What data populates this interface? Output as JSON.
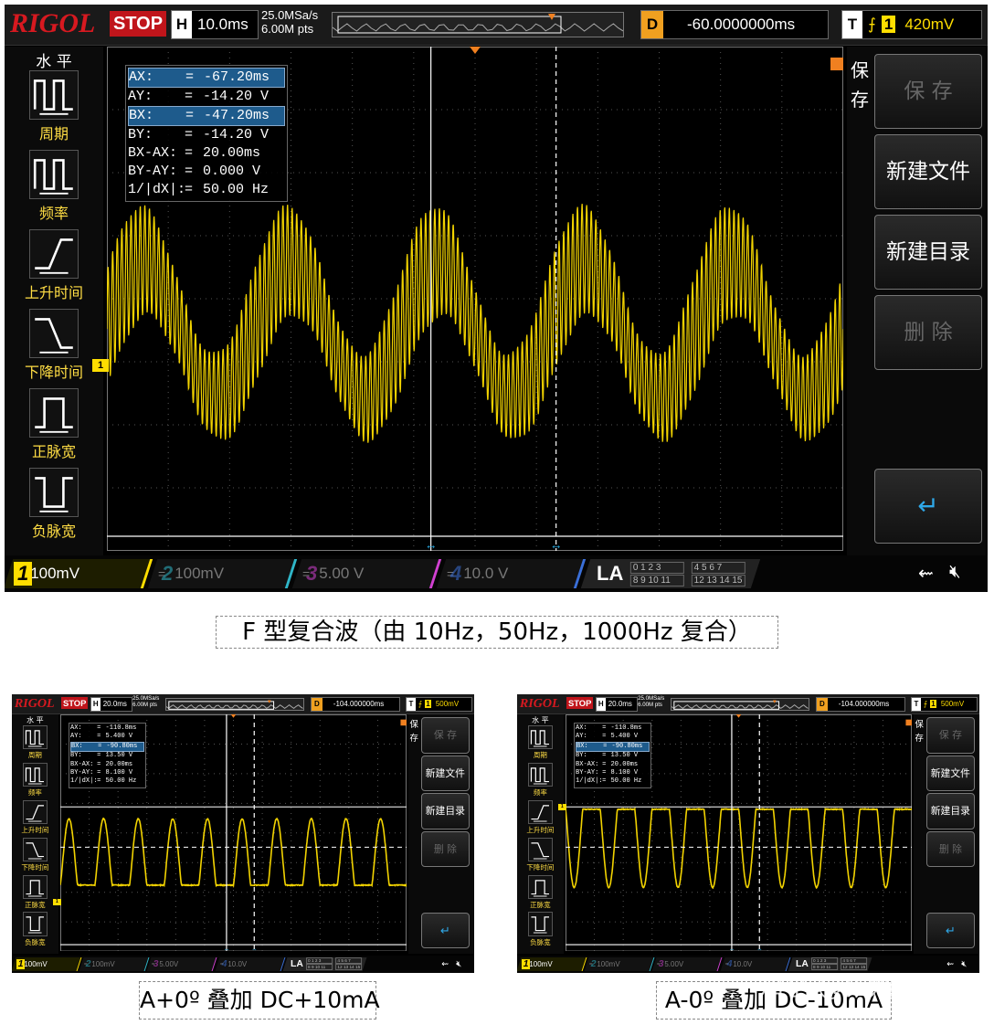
{
  "scopes": [
    {
      "id": "main",
      "brand": "RIGOL",
      "run_state": "STOP",
      "h_label": "H",
      "timebase": "10.0ms",
      "sample_rate": "25.0MSa/s",
      "memory_depth": "6.00M pts",
      "d_label": "D",
      "delay": "-60.0000000ms",
      "trigger_label": "T",
      "trigger_channel": "1",
      "trigger_level": "420mV",
      "menu_title": "水 平",
      "left_menu": [
        "周期",
        "频率",
        "上升时间",
        "下降时间",
        "正脉宽",
        "负脉宽"
      ],
      "right_menu_title": "保存",
      "right_menu": [
        {
          "label": "保 存",
          "enabled": false
        },
        {
          "label": "新建文件",
          "enabled": true
        },
        {
          "label": "新建目录",
          "enabled": true
        },
        {
          "label": "删 除",
          "enabled": false
        }
      ],
      "measurements": [
        {
          "name": "AX:",
          "value": "-67.20ms",
          "highlight": true
        },
        {
          "name": "AY:",
          "value": "-14.20 V",
          "highlight": false
        },
        {
          "name": "BX:",
          "value": "-47.20ms",
          "highlight": true
        },
        {
          "name": "BY:",
          "value": "-14.20 V",
          "highlight": false
        },
        {
          "name": "BX-AX:",
          "value": "20.00ms",
          "highlight": false
        },
        {
          "name": "BY-AY:",
          "value": "0.000 V",
          "highlight": false
        },
        {
          "name": "1/|dX|:",
          "value": "50.00 Hz",
          "highlight": false
        }
      ],
      "channels": [
        {
          "num": "1",
          "scale": "100mV",
          "color": "#ffde00"
        },
        {
          "num": "2",
          "scale": "100mV",
          "color": "#2fb6c8"
        },
        {
          "num": "3",
          "scale": "5.00 V",
          "color": "#d040d0"
        },
        {
          "num": "4",
          "scale": "10.0 V",
          "color": "#3a6fd8"
        }
      ],
      "la_label": "LA",
      "la_groups": [
        "0 1 2 3",
        "4 5 6 7",
        "8 9 10 11",
        "12 13 14 15"
      ]
    },
    {
      "id": "left",
      "brand": "RIGOL",
      "run_state": "STOP",
      "h_label": "H",
      "timebase": "20.0ms",
      "sample_rate": "25.0MSa/s",
      "memory_depth": "6.00M pts",
      "d_label": "D",
      "delay": "-104.000000ms",
      "trigger_label": "T",
      "trigger_channel": "1",
      "trigger_level": "500mV",
      "menu_title": "水 平",
      "left_menu": [
        "周期",
        "频率",
        "上升时间",
        "下降时间",
        "正脉宽",
        "负脉宽"
      ],
      "right_menu_title": "保存",
      "right_menu": [
        {
          "label": "保 存",
          "enabled": false
        },
        {
          "label": "新建文件",
          "enabled": true
        },
        {
          "label": "新建目录",
          "enabled": true
        },
        {
          "label": "删 除",
          "enabled": false
        }
      ],
      "measurements": [
        {
          "name": "AX:",
          "value": "-110.8ms",
          "highlight": false
        },
        {
          "name": "AY:",
          "value": "5.400 V",
          "highlight": false
        },
        {
          "name": "BX:",
          "value": "-90.80ms",
          "highlight": true
        },
        {
          "name": "BY:",
          "value": "13.50 V",
          "highlight": false
        },
        {
          "name": "BX-AX:",
          "value": "20.00ms",
          "highlight": false
        },
        {
          "name": "BY-AY:",
          "value": "8.100 V",
          "highlight": false
        },
        {
          "name": "1/|dX|:",
          "value": "50.00 Hz",
          "highlight": false
        }
      ],
      "channels": [
        {
          "num": "1",
          "scale": "100mV",
          "color": "#ffde00"
        },
        {
          "num": "2",
          "scale": "100mV",
          "color": "#2fb6c8"
        },
        {
          "num": "3",
          "scale": "5.00V",
          "color": "#d040d0"
        },
        {
          "num": "4",
          "scale": "10.0V",
          "color": "#3a6fd8"
        }
      ],
      "la_label": "LA",
      "la_groups": [
        "0 1 2 3",
        "4 5 6 7",
        "8 9 10 11",
        "12 13 14 15"
      ]
    },
    {
      "id": "right",
      "brand": "RIGOL",
      "run_state": "STOP",
      "h_label": "H",
      "timebase": "20.0ms",
      "sample_rate": "25.0MSa/s",
      "memory_depth": "6.00M pts",
      "d_label": "D",
      "delay": "-104.000000ms",
      "trigger_label": "T",
      "trigger_channel": "1",
      "trigger_level": "500mV",
      "menu_title": "水 平",
      "left_menu": [
        "周期",
        "频率",
        "上升时间",
        "下降时间",
        "正脉宽",
        "负脉宽"
      ],
      "right_menu_title": "保存",
      "right_menu": [
        {
          "label": "保 存",
          "enabled": false
        },
        {
          "label": "新建文件",
          "enabled": true
        },
        {
          "label": "新建目录",
          "enabled": true
        },
        {
          "label": "删 除",
          "enabled": false
        }
      ],
      "measurements": [
        {
          "name": "AX:",
          "value": "-110.8ms",
          "highlight": false
        },
        {
          "name": "AY:",
          "value": "5.400 V",
          "highlight": false
        },
        {
          "name": "BX:",
          "value": "-90.80ms",
          "highlight": true
        },
        {
          "name": "BY:",
          "value": "13.50 V",
          "highlight": false
        },
        {
          "name": "BX-AX:",
          "value": "20.00ms",
          "highlight": false
        },
        {
          "name": "BY-AY:",
          "value": "8.100 V",
          "highlight": false
        },
        {
          "name": "1/|dX|:",
          "value": "50.00 Hz",
          "highlight": false
        }
      ],
      "channels": [
        {
          "num": "1",
          "scale": "100mV",
          "color": "#ffde00"
        },
        {
          "num": "2",
          "scale": "100mV",
          "color": "#2fb6c8"
        },
        {
          "num": "3",
          "scale": "5.00V",
          "color": "#d040d0"
        },
        {
          "num": "4",
          "scale": "10.0V",
          "color": "#3a6fd8"
        }
      ],
      "la_label": "LA",
      "la_groups": [
        "0 1 2 3",
        "4 5 6 7",
        "8 9 10 11",
        "12 13 14 15"
      ]
    }
  ],
  "captions": {
    "main": "F 型复合波（由 10Hz，50Hz，1000Hz 复合）",
    "left": "A+0º 叠加 DC+10mA",
    "right": "A-0º 叠加 DC-10mA"
  },
  "watermark": "知乎 @拓勉科技",
  "colors": {
    "trace": "#ffde00",
    "brand": "#d71920",
    "stop": "#c0151b"
  }
}
